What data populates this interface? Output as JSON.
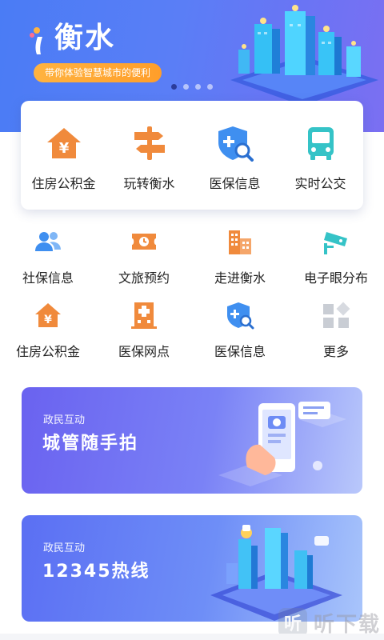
{
  "header": {
    "app_name": "衡水",
    "slogan": "带你体验智慧城市的便利",
    "carousel": {
      "count": 4,
      "active": 0
    }
  },
  "main_services": [
    {
      "label": "住房公积金",
      "icon": "house-yuan-icon"
    },
    {
      "label": "玩转衡水",
      "icon": "signpost-icon"
    },
    {
      "label": "医保信息",
      "icon": "shield-plus-search-icon"
    },
    {
      "label": "实时公交",
      "icon": "bus-icon"
    }
  ],
  "services": [
    [
      {
        "label": "社保信息",
        "icon": "people-icon"
      },
      {
        "label": "文旅预约",
        "icon": "ticket-clock-icon"
      },
      {
        "label": "走进衡水",
        "icon": "buildings-icon"
      },
      {
        "label": "电子眼分布",
        "icon": "cctv-camera-icon"
      }
    ],
    [
      {
        "label": "住房公积金",
        "icon": "house-yuan-icon"
      },
      {
        "label": "医保网点",
        "icon": "hospital-icon"
      },
      {
        "label": "医保信息",
        "icon": "shield-plus-search-icon"
      },
      {
        "label": "更多",
        "icon": "more-grid-icon"
      }
    ]
  ],
  "banners": [
    {
      "kicker": "政民互动",
      "title": "城管随手拍"
    },
    {
      "kicker": "政民互动",
      "title": "12345热线"
    }
  ],
  "watermark": {
    "logo": "听",
    "text": "听下载"
  },
  "colors": {
    "orange": "#f08a3c",
    "blue": "#3f8ff0",
    "teal": "#35c3c7",
    "grey": "#c9cdd4"
  }
}
